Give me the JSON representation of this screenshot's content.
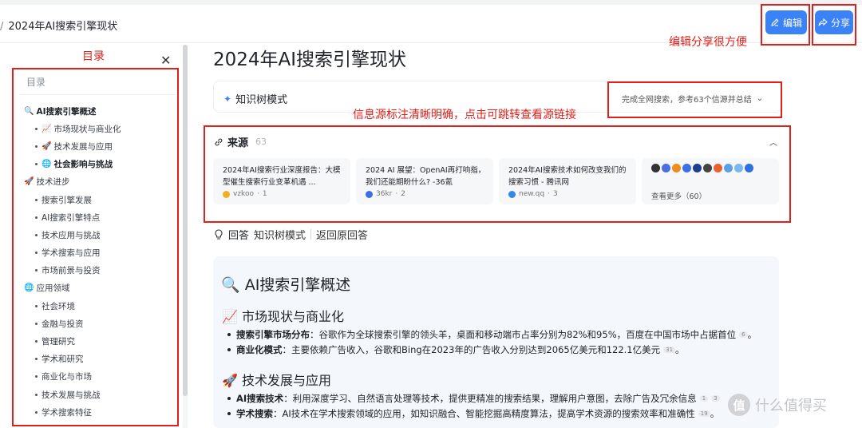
{
  "breadcrumb": {
    "separator": "/",
    "title": "2024年AI搜索引擎现状"
  },
  "toolbar": {
    "edit_label": "编辑",
    "share_label": "分享"
  },
  "annotations": {
    "toc": "目录",
    "edit_share": "编辑分享很方便",
    "sources": "信息源标注清晰明确，点击可跳转查看源链接"
  },
  "toc": {
    "title": "目录",
    "items": [
      {
        "level": 1,
        "emoji": "🔍",
        "label": "AI搜索引擎概述",
        "bold": true
      },
      {
        "level": 2,
        "emoji": "📈",
        "label": "市场现状与商业化",
        "bold": false
      },
      {
        "level": 2,
        "emoji": "🚀",
        "label": "技术发展与应用",
        "bold": false
      },
      {
        "level": 2,
        "emoji": "🌐",
        "label": "社会影响与挑战",
        "bold": true
      },
      {
        "level": 1,
        "emoji": "🚀",
        "label": "技术进步",
        "bold": false
      },
      {
        "level": 2,
        "emoji": "",
        "label": "搜索引擎发展",
        "bold": false
      },
      {
        "level": 2,
        "emoji": "",
        "label": "AI搜索引擎特点",
        "bold": false
      },
      {
        "level": 2,
        "emoji": "",
        "label": "技术应用与挑战",
        "bold": false
      },
      {
        "level": 2,
        "emoji": "",
        "label": "学术搜索与应用",
        "bold": false
      },
      {
        "level": 2,
        "emoji": "",
        "label": "市场前景与投资",
        "bold": false
      },
      {
        "level": 1,
        "emoji": "🌐",
        "label": "应用领域",
        "bold": false
      },
      {
        "level": 2,
        "emoji": "",
        "label": "社会环境",
        "bold": false
      },
      {
        "level": 2,
        "emoji": "",
        "label": "金融与投资",
        "bold": false
      },
      {
        "level": 2,
        "emoji": "",
        "label": "管理研究",
        "bold": false
      },
      {
        "level": 2,
        "emoji": "",
        "label": "学术和研究",
        "bold": false
      },
      {
        "level": 2,
        "emoji": "",
        "label": "商业化与市场",
        "bold": false
      },
      {
        "level": 2,
        "emoji": "",
        "label": "技术发展与挑战",
        "bold": false
      },
      {
        "level": 2,
        "emoji": "",
        "label": "学术搜索特征",
        "bold": false
      }
    ]
  },
  "main": {
    "title": "2024年AI搜索引擎现状",
    "knowledge_tree": {
      "label": "知识树模式",
      "summary": "完成全网搜索，参考63个信源并总结"
    },
    "sources": {
      "title": "来源",
      "count": "63",
      "cards": [
        {
          "title": "2024年AI搜索行业深度报告：大模型催生搜索行业变革机遇 ...",
          "site": "vzkoo",
          "index": "1",
          "color": "#f2b01e"
        },
        {
          "title": "2024 AI 展望：OpenAI再打响指，我们还能期盼什么? -36氪",
          "site": "36kr",
          "index": "2",
          "color": "#3b6fe8"
        },
        {
          "title": "2024年AI搜索技术如何改变我们的搜索习惯 - 腾讯网",
          "site": "new.qq",
          "index": "3",
          "color": "#2f8ae8"
        }
      ],
      "more_label": "查看更多（60）",
      "more_icon_colors": [
        "#333333",
        "#4a6fe3",
        "#f08c1a",
        "#3b6fe8",
        "#1c3f8f",
        "#444444",
        "#e8622b",
        "#5aa0e8",
        "#7ab8f0",
        "#2f6fe0"
      ]
    },
    "answer_bar": {
      "answer_label": "回答",
      "tree_label": "知识树模式",
      "back_label": "返回原回答"
    },
    "answer": {
      "h2": "🔍 AI搜索引擎概述",
      "sections": [
        {
          "heading": "📈 市场现状与商业化",
          "bullets": [
            {
              "term": "搜索引擎市场分布",
              "text": "：谷歌作为全球搜索引擎的领头羊，桌面和移动端市占率分别为82%和95%，百度在中国市场中占据首位",
              "refs": [
                "6"
              ],
              "tail": "。"
            },
            {
              "term": "商业化模式",
              "text": "：主要依赖广告收入，谷歌和Bing在2023年的广告收入分别达到2065亿美元和122.1亿美元",
              "refs": [
                "31"
              ],
              "tail": "。"
            }
          ]
        },
        {
          "heading": "🚀 技术发展与应用",
          "bullets": [
            {
              "term": "AI搜索技术",
              "text": "：利用深度学习、自然语言处理等技术，提供更精准的搜索结果，理解用户意图，去除广告及冗余信息",
              "refs": [
                "1",
                "3"
              ],
              "tail": ""
            },
            {
              "term": "学术搜索",
              "text": "：AI技术在学术搜索领域的应用，如知识融合、智能挖掘高精度算法，提高学术资源的搜索效率和准确性",
              "refs": [
                "19"
              ],
              "tail": "。"
            }
          ]
        }
      ]
    }
  },
  "watermark": {
    "badge": "值",
    "text": "什么值得买"
  }
}
